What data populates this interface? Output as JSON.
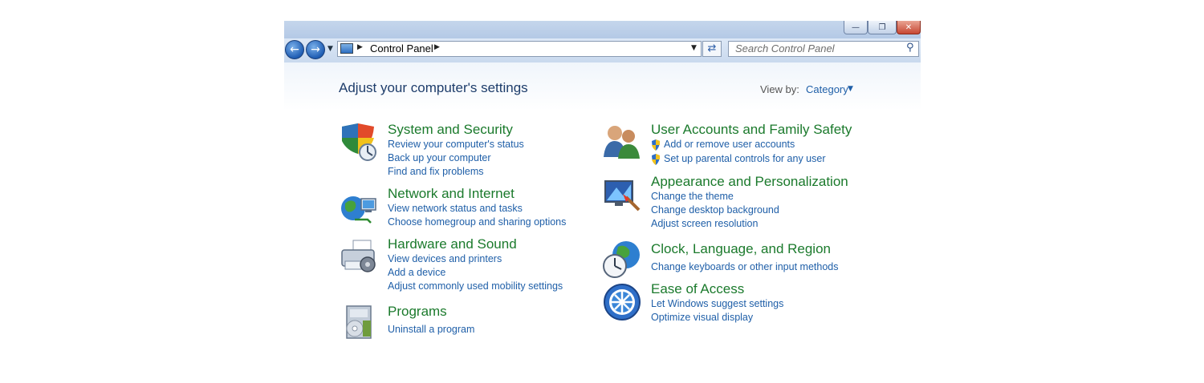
{
  "address": {
    "path": "Control Panel"
  },
  "search": {
    "placeholder": "Search Control Panel"
  },
  "header": {
    "title": "Adjust your computer's settings",
    "view_by_label": "View by:",
    "view_by_value": "Category"
  },
  "categories": [
    {
      "icon": "shield-icon",
      "title": "System and Security",
      "links": [
        "Review your computer's status",
        "Back up your computer",
        "Find and fix problems"
      ]
    },
    {
      "icon": "network-globe-icon",
      "title": "Network and Internet",
      "links": [
        "View network status and tasks",
        "Choose homegroup and sharing options"
      ]
    },
    {
      "icon": "printer-icon",
      "title": "Hardware and Sound",
      "links": [
        "View devices and printers",
        "Add a device",
        "Adjust commonly used mobility settings"
      ]
    },
    {
      "icon": "programs-box-icon",
      "title": "Programs",
      "links": [
        "Uninstall a program"
      ]
    },
    {
      "icon": "users-icon",
      "title": "User Accounts and Family Safety",
      "links": [
        "Add or remove user accounts",
        "Set up parental controls for any user"
      ]
    },
    {
      "icon": "paint-monitor-icon",
      "title": "Appearance and Personalization",
      "links": [
        "Change the theme",
        "Change desktop background",
        "Adjust screen resolution"
      ]
    },
    {
      "icon": "clock-globe-icon",
      "title": "Clock, Language, and Region",
      "links": [
        "Change keyboards or other input methods"
      ]
    },
    {
      "icon": "ease-of-access-icon",
      "title": "Ease of Access",
      "links": [
        "Let Windows suggest settings",
        "Optimize visual display"
      ]
    }
  ],
  "colors": {
    "category_title": "#1b7a2c",
    "link": "#1f5fa8",
    "page_title": "#1e3d6b"
  }
}
